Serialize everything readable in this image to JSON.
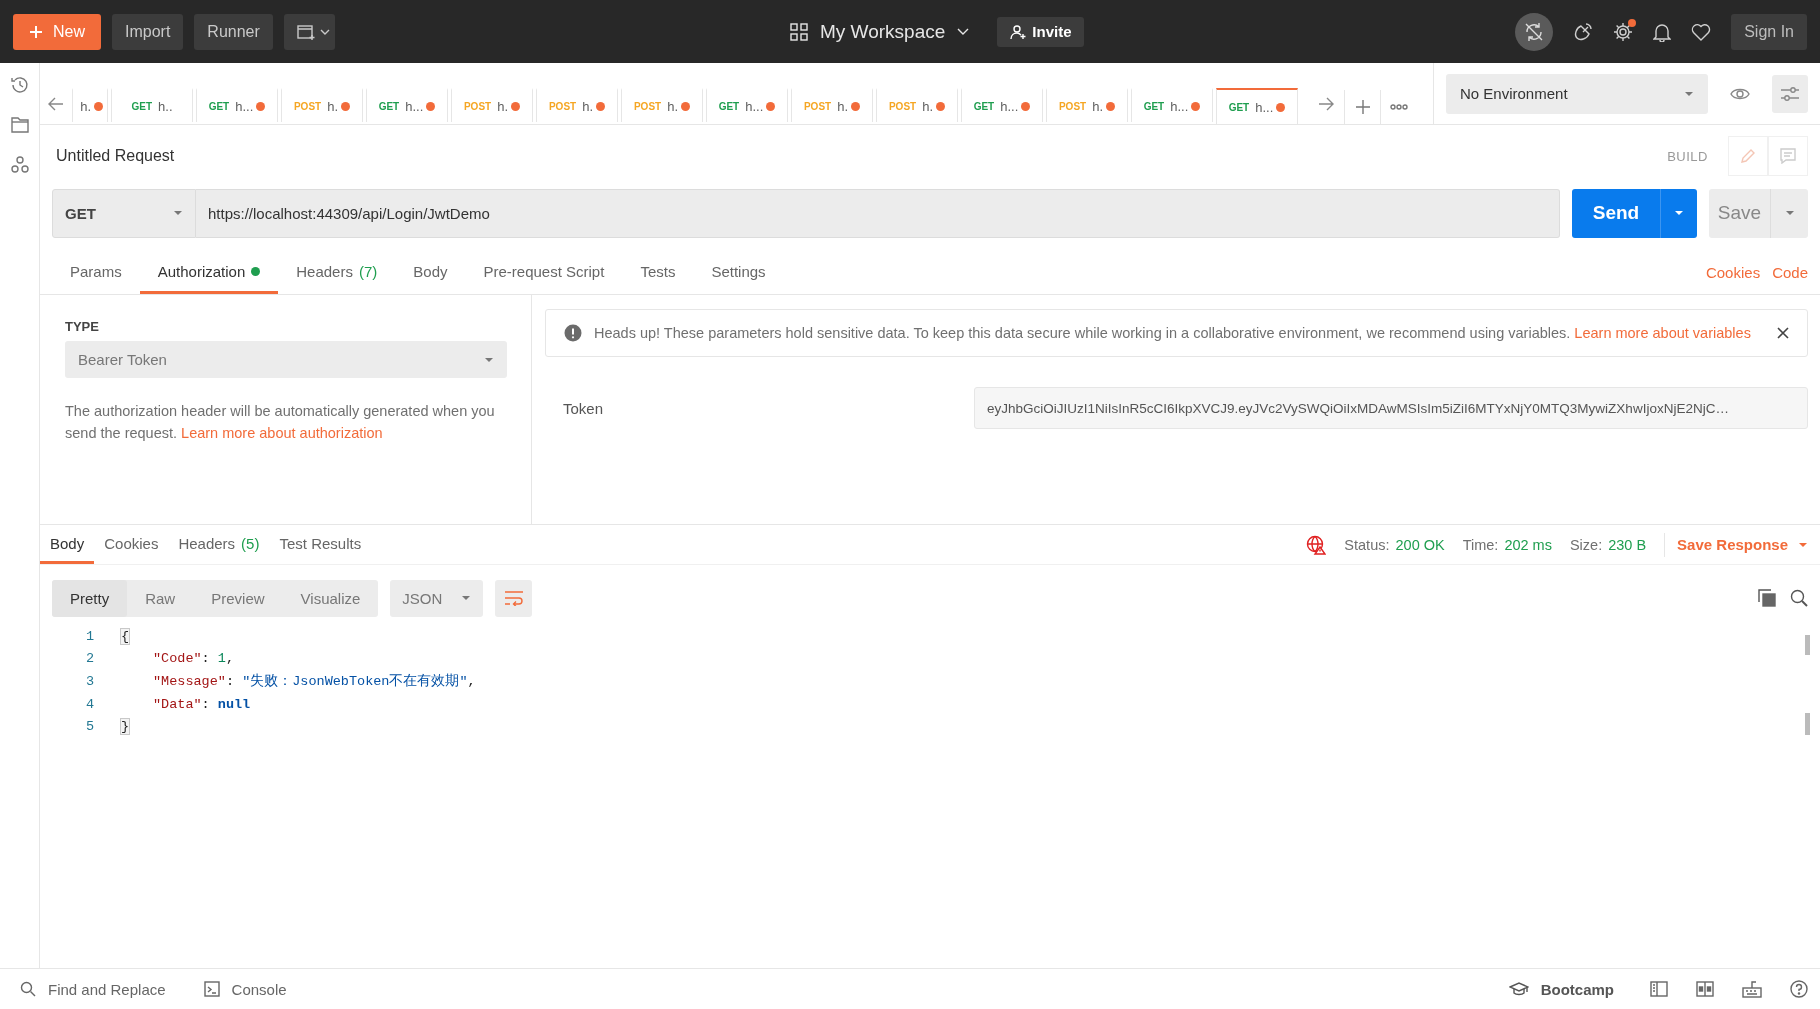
{
  "topbar": {
    "new_button": "New",
    "import_button": "Import",
    "runner_button": "Runner",
    "workspace": "My Workspace",
    "invite_button": "Invite",
    "settings_badge": true,
    "sign_in_button": "Sign In"
  },
  "tabs": [
    {
      "name": "h.",
      "unsaved": true,
      "selected": false
    },
    {
      "method": "GET",
      "name": "h..",
      "unsaved": false,
      "selected": false
    },
    {
      "method": "GET",
      "name": "h...",
      "unsaved": true,
      "selected": false
    },
    {
      "method": "POST",
      "name": "h.",
      "unsaved": true,
      "selected": false
    },
    {
      "method": "GET",
      "name": "h...",
      "unsaved": true,
      "selected": false
    },
    {
      "method": "POST",
      "name": "h.",
      "unsaved": true,
      "selected": false
    },
    {
      "method": "POST",
      "name": "h.",
      "unsaved": true,
      "selected": false
    },
    {
      "method": "POST",
      "name": "h.",
      "unsaved": true,
      "selected": false
    },
    {
      "method": "GET",
      "name": "h...",
      "unsaved": true,
      "selected": false
    },
    {
      "method": "POST",
      "name": "h.",
      "unsaved": true,
      "selected": false
    },
    {
      "method": "POST",
      "name": "h.",
      "unsaved": true,
      "selected": false
    },
    {
      "method": "GET",
      "name": "h...",
      "unsaved": true,
      "selected": false
    },
    {
      "method": "POST",
      "name": "h.",
      "unsaved": true,
      "selected": false
    },
    {
      "method": "GET",
      "name": "h...",
      "unsaved": true,
      "selected": false
    },
    {
      "method": "GET",
      "name": "h...",
      "unsaved": true,
      "selected": true
    }
  ],
  "environment": {
    "value": "No Environment"
  },
  "request": {
    "title": "Untitled Request",
    "build_label": "BUILD",
    "method": "GET",
    "url": "https://localhost:44309/api/Login/JwtDemo",
    "send_button": "Send",
    "save_button": "Save"
  },
  "request_sections": [
    {
      "label": "Params",
      "selected": false
    },
    {
      "label": "Authorization",
      "indicator": true,
      "selected": true
    },
    {
      "label": "Headers",
      "count": "(7)",
      "selected": false
    },
    {
      "label": "Body",
      "selected": false
    },
    {
      "label": "Pre-request Script",
      "selected": false
    },
    {
      "label": "Tests",
      "selected": false
    },
    {
      "label": "Settings",
      "selected": false
    }
  ],
  "request_links": [
    "Cookies",
    "Code"
  ],
  "authorization": {
    "type_label": "TYPE",
    "type": "Bearer Token",
    "description": "The authorization header will be automatically generated when you send the request.",
    "description_link": "Learn more about authorization",
    "notice": "Heads up! These parameters hold sensitive data. To keep this data secure while working in a collaborative environment, we recommend using variables.",
    "notice_link": "Learn more about variables",
    "token_label": "Token",
    "token": "eyJhbGciOiJIUzI1NiIsInR5cCI6IkpXVCJ9.eyJVc2VySWQiOiIxMDAwMSIsIm5iZiI6MTYxNjY0MTQ3MywiZXhwIjoxNjE2NjC…"
  },
  "response_sections": [
    {
      "label": "Body",
      "selected": true
    },
    {
      "label": "Cookies",
      "selected": false
    },
    {
      "label": "Headers",
      "count": "(5)",
      "selected": false
    },
    {
      "label": "Test Results",
      "selected": false
    }
  ],
  "response_meta": [
    {
      "label": "Status:",
      "value": "200 OK"
    },
    {
      "label": "Time:",
      "value": "202 ms"
    },
    {
      "label": "Size:",
      "value": "230 B"
    }
  ],
  "save_response": "Save Response",
  "view_modes": [
    {
      "label": "Pretty",
      "selected": true
    },
    {
      "label": "Raw",
      "selected": false
    },
    {
      "label": "Preview",
      "selected": false
    },
    {
      "label": "Visualize",
      "selected": false
    }
  ],
  "format": "JSON",
  "wrap_lines": true,
  "code_lines": [
    {
      "number": "1",
      "indented": false,
      "tokens": [
        {
          "kind": "brace",
          "text": "{",
          "matched": true
        }
      ]
    },
    {
      "number": "2",
      "indented": true,
      "tokens": [
        {
          "kind": "key",
          "text": "\"Code\""
        },
        {
          "kind": "punct",
          "text": ": "
        },
        {
          "kind": "number",
          "text": "1"
        },
        {
          "kind": "punct",
          "text": ","
        }
      ]
    },
    {
      "number": "3",
      "indented": true,
      "tokens": [
        {
          "kind": "key",
          "text": "\"Message\""
        },
        {
          "kind": "punct",
          "text": ": "
        },
        {
          "kind": "string",
          "text": "\"失败：JsonWebToken不在有效期\""
        },
        {
          "kind": "punct",
          "text": ","
        }
      ]
    },
    {
      "number": "4",
      "indented": true,
      "tokens": [
        {
          "kind": "key",
          "text": "\"Data\""
        },
        {
          "kind": "punct",
          "text": ": "
        },
        {
          "kind": "null",
          "text": "null"
        }
      ]
    },
    {
      "number": "5",
      "indented": false,
      "tokens": [
        {
          "kind": "brace",
          "text": "}",
          "matched": true
        }
      ]
    }
  ],
  "footer": {
    "left": [
      {
        "kind": "find",
        "label": "Find and Replace"
      },
      {
        "kind": "console",
        "label": "Console"
      }
    ],
    "bootcamp": "Bootcamp"
  }
}
